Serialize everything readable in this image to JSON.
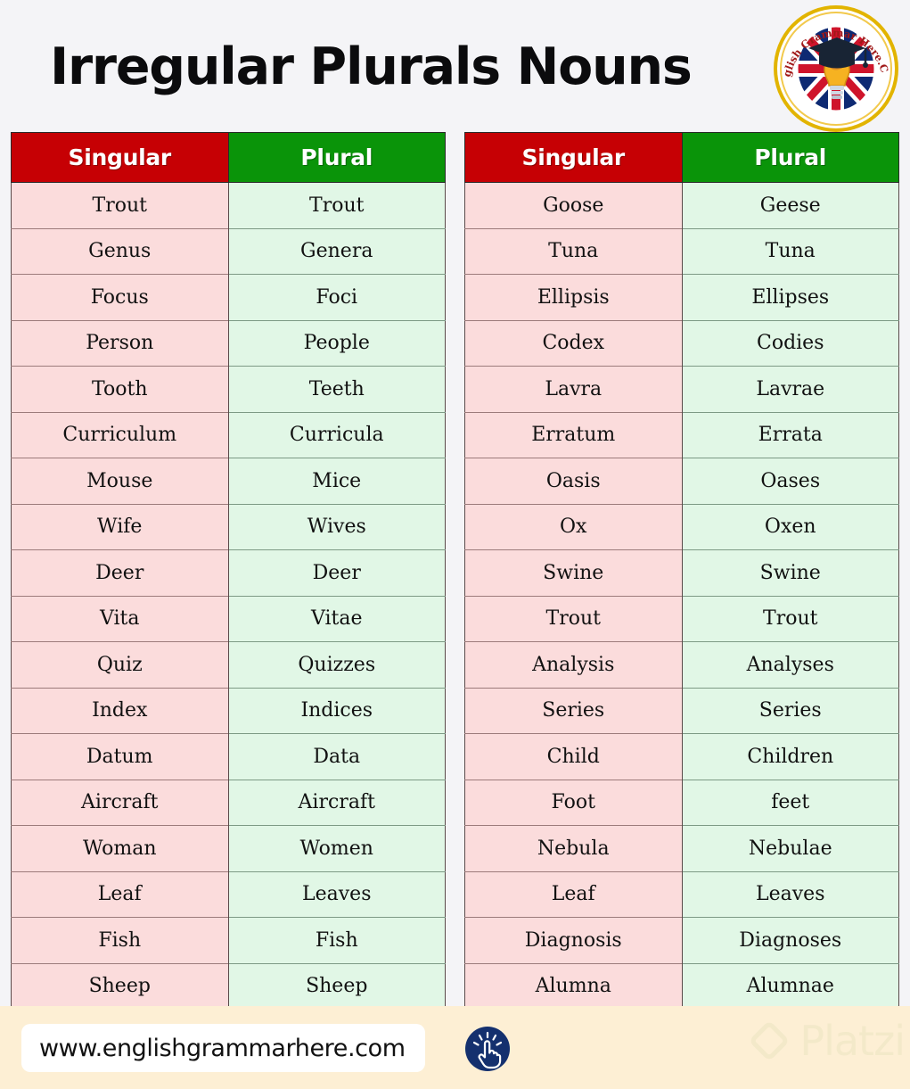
{
  "header": {
    "title": "Irregular Plurals Nouns",
    "logo": {
      "arc_top_text": "English Grammar",
      "arc_bottom_text": "Here.Com",
      "full_text": "English Grammar Here.Com",
      "alt": "graduation-cap-lightbulb-uk-flag-logo"
    }
  },
  "columns": {
    "singular": "Singular",
    "plural": "Plural"
  },
  "colors": {
    "header_singular_bg": "#c60004",
    "header_plural_bg": "#0a9409",
    "cell_singular_bg": "#fbdcdc",
    "cell_plural_bg": "#e1f7e6",
    "page_bg": "#f4f4f7",
    "footer_bg": "#fdefd4",
    "click_badge_bg": "#14306e",
    "watermark": "#f3e9c9"
  },
  "left_table": {
    "headers": [
      "Singular",
      "Plural"
    ],
    "rows": [
      {
        "singular": "Trout",
        "plural": "Trout"
      },
      {
        "singular": "Genus",
        "plural": "Genera"
      },
      {
        "singular": "Focus",
        "plural": "Foci"
      },
      {
        "singular": "Person",
        "plural": "People"
      },
      {
        "singular": "Tooth",
        "plural": "Teeth"
      },
      {
        "singular": "Curriculum",
        "plural": "Curricula"
      },
      {
        "singular": "Mouse",
        "plural": "Mice"
      },
      {
        "singular": "Wife",
        "plural": "Wives"
      },
      {
        "singular": "Deer",
        "plural": "Deer"
      },
      {
        "singular": "Vita",
        "plural": "Vitae"
      },
      {
        "singular": "Quiz",
        "plural": "Quizzes"
      },
      {
        "singular": "Index",
        "plural": "Indices"
      },
      {
        "singular": "Datum",
        "plural": "Data"
      },
      {
        "singular": "Aircraft",
        "plural": "Aircraft"
      },
      {
        "singular": "Woman",
        "plural": "Women"
      },
      {
        "singular": "Leaf",
        "plural": "Leaves"
      },
      {
        "singular": "Fish",
        "plural": "Fish"
      },
      {
        "singular": "Sheep",
        "plural": "Sheep"
      }
    ]
  },
  "right_table": {
    "headers": [
      "Singular",
      "Plural"
    ],
    "rows": [
      {
        "singular": "Goose",
        "plural": "Geese"
      },
      {
        "singular": "Tuna",
        "plural": "Tuna"
      },
      {
        "singular": "Ellipsis",
        "plural": "Ellipses"
      },
      {
        "singular": "Codex",
        "plural": "Codies"
      },
      {
        "singular": "Lavra",
        "plural": "Lavrae"
      },
      {
        "singular": "Erratum",
        "plural": "Errata"
      },
      {
        "singular": "Oasis",
        "plural": "Oases"
      },
      {
        "singular": "Ox",
        "plural": "Oxen"
      },
      {
        "singular": "Swine",
        "plural": "Swine"
      },
      {
        "singular": "Trout",
        "plural": "Trout"
      },
      {
        "singular": "Analysis",
        "plural": "Analyses"
      },
      {
        "singular": "Series",
        "plural": "Series"
      },
      {
        "singular": "Child",
        "plural": "Children"
      },
      {
        "singular": "Foot",
        "plural": "feet"
      },
      {
        "singular": "Nebula",
        "plural": "Nebulae"
      },
      {
        "singular": "Leaf",
        "plural": "Leaves"
      },
      {
        "singular": "Diagnosis",
        "plural": "Diagnoses"
      },
      {
        "singular": "Alumna",
        "plural": "Alumnae"
      }
    ]
  },
  "footer": {
    "url": "www.englishgrammarhere.com",
    "click_icon": "click-hand-icon",
    "watermark_text": "Platzi",
    "watermark_icon": "platzi-diamond-icon"
  }
}
